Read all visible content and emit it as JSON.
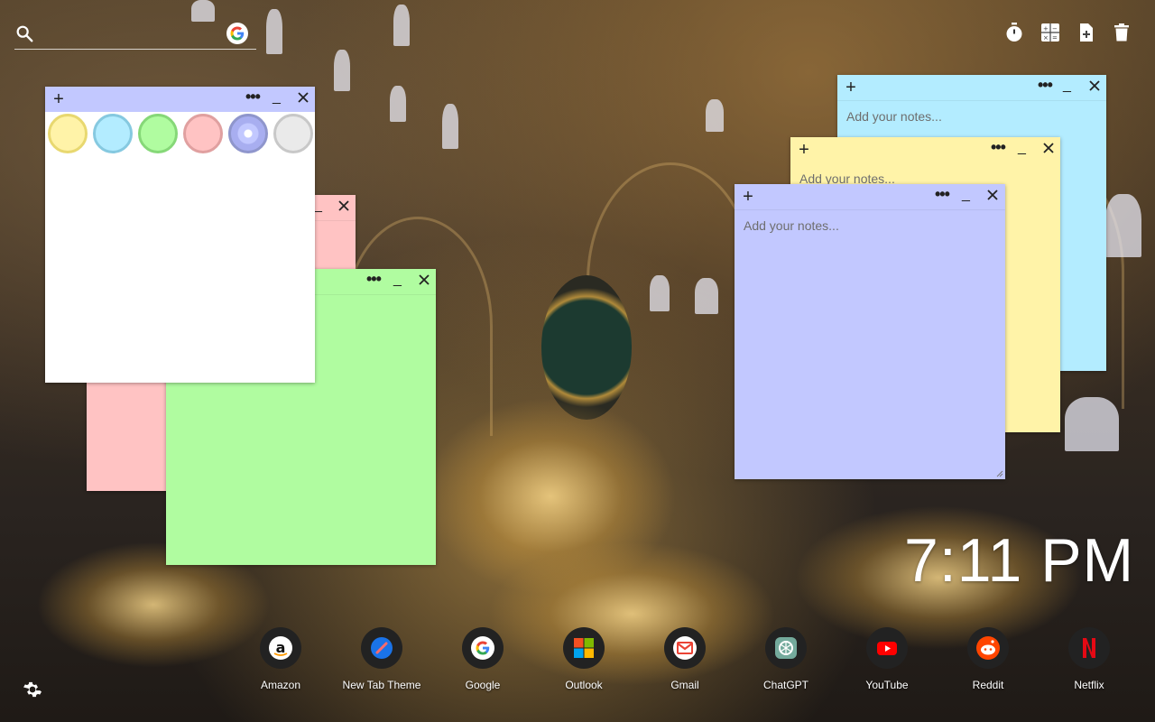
{
  "top_bar": {
    "search_icon": "search-icon",
    "google_icon": "google-icon",
    "tools": [
      "timer-icon",
      "calculator-icon",
      "new-note-icon",
      "trash-icon"
    ]
  },
  "notes": [
    {
      "id": "blue",
      "color": "#b3ecff",
      "placeholder": "Add your notes..."
    },
    {
      "id": "yellow",
      "color": "#fff3a8",
      "placeholder": "Add your notes..."
    },
    {
      "id": "periwinkle",
      "color": "#c2c8ff",
      "placeholder": "Add your notes..."
    },
    {
      "id": "pink",
      "color": "#ffc3c3"
    },
    {
      "id": "green",
      "color": "#b0fca0"
    },
    {
      "id": "white",
      "color": "#ffffff",
      "header_color": "#c2c8ff"
    }
  ],
  "color_swatches": [
    {
      "name": "yellow",
      "color": "#fff3a8",
      "ring": "#e8d870"
    },
    {
      "name": "blue",
      "color": "#b3ecff",
      "ring": "#86c9e0"
    },
    {
      "name": "green",
      "color": "#b0fca0",
      "ring": "#86d878"
    },
    {
      "name": "pink",
      "color": "#ffc3c3",
      "ring": "#e0a0a0"
    },
    {
      "name": "periwinkle",
      "color": "#c2c8ff",
      "ring": "#8f96cc",
      "selected": true
    },
    {
      "name": "gray",
      "color": "#eaeaea",
      "ring": "#c8c8c8"
    }
  ],
  "clock": {
    "time": "7:11 PM"
  },
  "dock": [
    {
      "label": "Amazon",
      "icon": "amazon-icon"
    },
    {
      "label": "New Tab Theme",
      "icon": "new-tab-theme-icon"
    },
    {
      "label": "Google",
      "icon": "google-icon"
    },
    {
      "label": "Outlook",
      "icon": "outlook-icon"
    },
    {
      "label": "Gmail",
      "icon": "gmail-icon"
    },
    {
      "label": "ChatGPT",
      "icon": "chatgpt-icon"
    },
    {
      "label": "YouTube",
      "icon": "youtube-icon"
    },
    {
      "label": "Reddit",
      "icon": "reddit-icon"
    },
    {
      "label": "Netflix",
      "icon": "netflix-icon"
    }
  ],
  "settings": {
    "icon": "gear-icon"
  }
}
